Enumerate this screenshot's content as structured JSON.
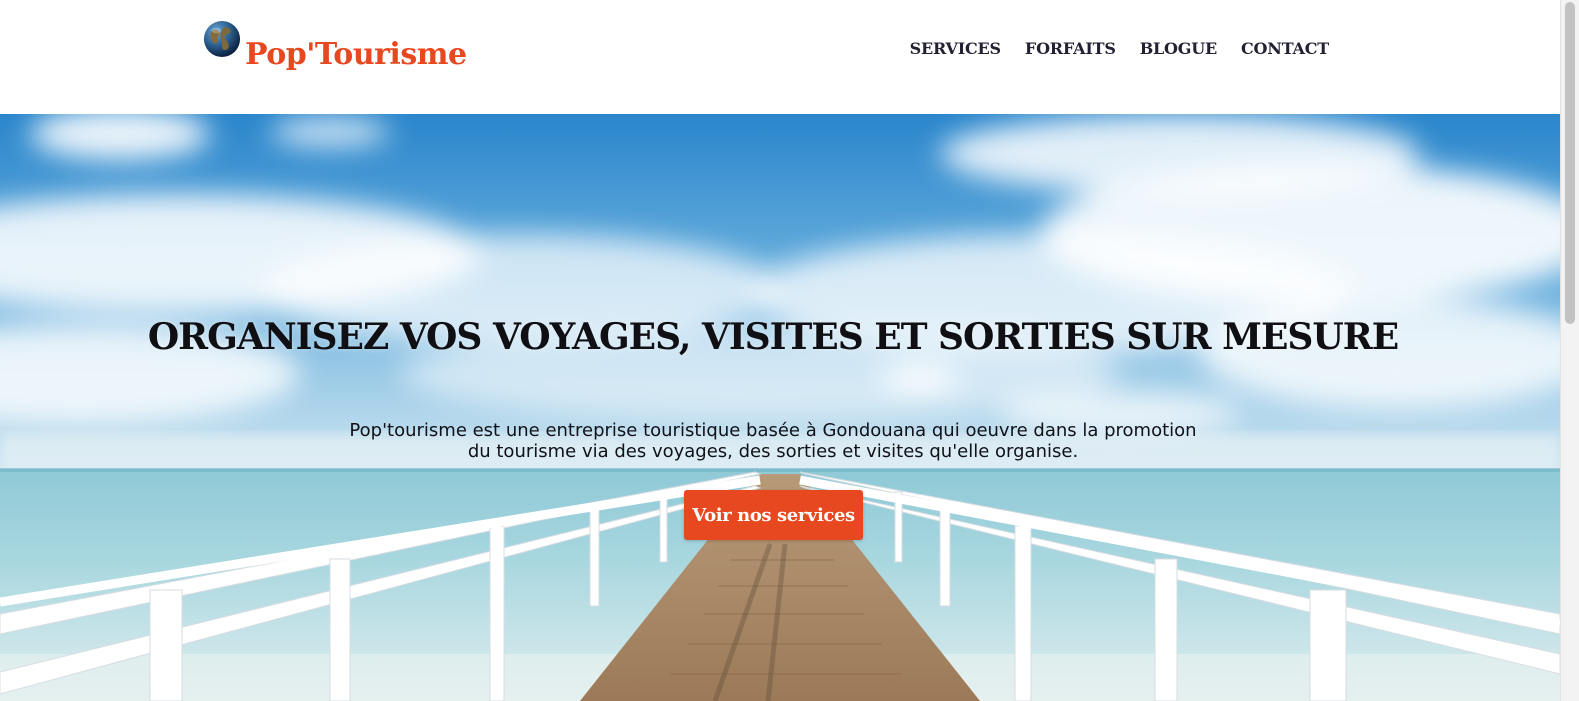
{
  "brand": {
    "name": "Pop'Tourisme",
    "logo_icon": "globe-icon",
    "color": "#e8481f"
  },
  "nav": {
    "items": [
      {
        "label": "SERVICES"
      },
      {
        "label": "FORFAITS"
      },
      {
        "label": "BLOGUE"
      },
      {
        "label": "CONTACT"
      }
    ]
  },
  "hero": {
    "title": "ORGANISEZ VOS VOYAGES, VISITES ET SORTIES SUR MESURE",
    "description": "Pop'tourisme est une entreprise touristique basée à Gondouana qui oeuvre dans la promotion du tourisme via des voyages, des sorties et visites qu'elle organise.",
    "cta_label": "Voir nos services",
    "cta_color": "#e8481f",
    "background": "pier-over-sea-photo"
  }
}
